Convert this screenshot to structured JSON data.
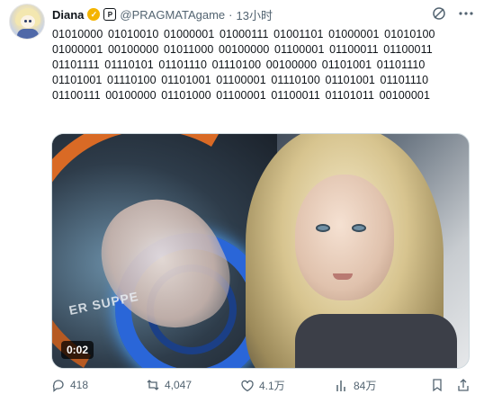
{
  "user": {
    "name": "Diana",
    "handle": "@PRAGMATAgame",
    "dot": "·",
    "time": "13小时"
  },
  "tweet": {
    "text": "01010000 01010010 01000001 01000111 01001101 01000001 01010100 01000001 00100000 01011000 00100000 01100001 01100011 01100011 01101111 01110101 01101110 01110100 00100000 01101001 01101110 01101001 01110100 01101001 01100001 01110100 01101001 01101110 01100111 00100000 01101000 01100001 01100011 01101011 00100001"
  },
  "media": {
    "overlay_text": "ER SUPPE",
    "duration": "0:02"
  },
  "actions": {
    "replies": "418",
    "reposts": "4,047",
    "likes": "4.1万",
    "views": "84万"
  },
  "colors": {
    "verified": "#f4b400",
    "muted": "#536471",
    "text": "#0f1419",
    "ring": "#2a66d8",
    "arc": "#d96a25"
  },
  "icons": [
    "verified-badge-icon",
    "pragmata-badge-icon",
    "grok-icon",
    "more-icon",
    "reply-icon",
    "repost-icon",
    "like-icon",
    "views-icon",
    "bookmark-icon",
    "share-icon"
  ]
}
